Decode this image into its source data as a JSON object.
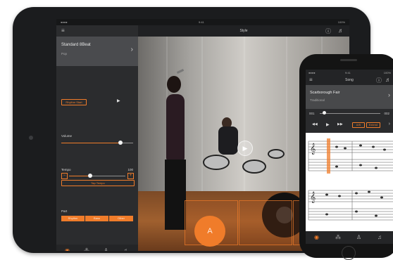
{
  "tablet": {
    "status": {
      "time": "9:41",
      "battery": "100%"
    },
    "top_bar": {
      "title": "Style"
    },
    "style_selector": {
      "name": "Standard 8Beat",
      "category": "Pop"
    },
    "rhythm_button": "Rhythm Start",
    "volume": {
      "label": "Volume",
      "level": 0.82
    },
    "tempo": {
      "label": "Tempo",
      "value": "100",
      "level": 0.38,
      "minus": "−",
      "plus": "+",
      "tap_label": "Tap Tempo"
    },
    "part": {
      "label": "Part",
      "segments": [
        "Rhythm",
        "Bass",
        "Other"
      ]
    },
    "fab_label": "A"
  },
  "phone": {
    "status": {
      "time": "9:41",
      "battery": "100%"
    },
    "top_bar": {
      "title": "Song"
    },
    "song": {
      "title": "Scarborough Fair",
      "subtitle": "Traditional"
    },
    "position": {
      "start": "001",
      "end": "002",
      "level": 0.07
    },
    "controls": {
      "a_b_label": "A/B",
      "extend_label": "Extend"
    }
  },
  "colors": {
    "accent": "#f07c2a",
    "panel": "#2b2c2e"
  },
  "icons": [
    "menu-icon",
    "help-icon",
    "music-stand-icon",
    "chevron-right-icon",
    "play-icon",
    "song-tab-icon",
    "style-tab-icon",
    "metronome-icon",
    "score-icon",
    "rewind-icon",
    "fast-forward-icon"
  ]
}
